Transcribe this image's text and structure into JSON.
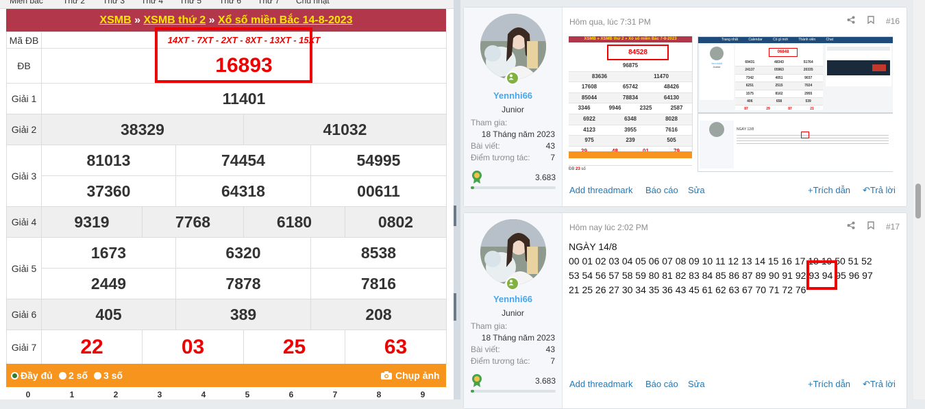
{
  "nav": [
    "Miền bắc",
    "Thứ 2",
    "Thứ 3",
    "Thứ 4",
    "Thứ 5",
    "Thứ 6",
    "Thứ 7",
    "Chủ nhật"
  ],
  "lottery": {
    "breadcrumb": [
      "XSMB",
      "XSMB thứ 2",
      "Xổ số miền Bắc 14-8-2023"
    ],
    "separator": "»",
    "ma_db_label": "Mã ĐB",
    "ma_db_value": "14XT - 7XT - 2XT - 8XT - 13XT - 15XT",
    "prizes": [
      {
        "label": "ĐB",
        "rows": [
          [
            "16893"
          ]
        ]
      },
      {
        "label": "Giải 1",
        "rows": [
          [
            "11401"
          ]
        ]
      },
      {
        "label": "Giải 2",
        "rows": [
          [
            "38329",
            "41032"
          ]
        ]
      },
      {
        "label": "Giải 3",
        "rows": [
          [
            "81013",
            "74454",
            "54995"
          ],
          [
            "37360",
            "64318",
            "00611"
          ]
        ]
      },
      {
        "label": "Giải 4",
        "rows": [
          [
            "9319",
            "7768",
            "6180",
            "0802"
          ]
        ]
      },
      {
        "label": "Giải 5",
        "rows": [
          [
            "1673",
            "6320",
            "8538"
          ],
          [
            "2449",
            "7878",
            "7816"
          ]
        ]
      },
      {
        "label": "Giải 6",
        "rows": [
          [
            "405",
            "389",
            "208"
          ]
        ]
      },
      {
        "label": "Giải 7",
        "rows": [
          [
            "22",
            "03",
            "25",
            "63"
          ]
        ]
      }
    ],
    "options": [
      "Đầy đủ",
      "2 số",
      "3 số"
    ],
    "capture_label": "Chụp ảnh",
    "digits": [
      "0",
      "1",
      "2",
      "3",
      "4",
      "5",
      "6",
      "7",
      "8",
      "9"
    ]
  },
  "posts": [
    {
      "date": "Hôm qua, lúc 7:31 PM",
      "number": "#16",
      "user": {
        "name": "Yennhi66",
        "title": "Junior",
        "joined_label": "Tham gia:",
        "joined": "18 Tháng năm 2023",
        "posts_label": "Bài viết:",
        "posts": "43",
        "reaction_label": "Điểm tương tác:",
        "reaction": "7",
        "points": "3.683"
      },
      "image": {
        "title": "XSMB » XSMB thứ 2 » Xổ số miền Bắc 7-8-2023",
        "db": "84528",
        "rows": [
          [
            "96875"
          ],
          [
            "83636",
            "11470"
          ],
          [
            "17608",
            "65742",
            "48426"
          ],
          [
            "85044",
            "78834",
            "64130"
          ],
          [
            "3346",
            "9946",
            "2325",
            "2587"
          ],
          [
            "6922",
            "6348",
            "8028"
          ],
          [
            "4123",
            "3955",
            "7616"
          ],
          [
            "975",
            "239",
            "505"
          ],
          [
            "29",
            "48",
            "01",
            "79"
          ]
        ],
        "inner_db": "06848",
        "inner_rows": [
          [
            "69431",
            "48343",
            "51764"
          ],
          [
            "24137",
            "05963",
            "20335"
          ],
          [
            "7342",
            "4051",
            "9037"
          ],
          [
            "6251",
            "2515",
            "7024"
          ],
          [
            "1575",
            "8162",
            "2955"
          ],
          [
            "406",
            "658",
            "539"
          ],
          [
            "87",
            "29",
            "87",
            "21"
          ]
        ],
        "inner_user": "Yennhi66",
        "inner_title": "Junior",
        "caption": "NGÀY 12/8",
        "bottom_label": "ĐB",
        "bottom_num": "23",
        "bottom_suffix": "số",
        "menu": [
          "Trang nhất",
          "Calendar",
          "Có gì mới",
          "Thành viên",
          "Chat"
        ]
      },
      "actions": {
        "threadmark": "Add threadmark",
        "report": "Báo cáo",
        "edit": "Sửa",
        "quote": "Trích dẫn",
        "reply": "Trả lời"
      }
    },
    {
      "date": "Hôm nay lúc 2:02 PM",
      "number": "#17",
      "user": {
        "name": "Yennhi66",
        "title": "Junior",
        "joined_label": "Tham gia:",
        "joined": "18 Tháng năm 2023",
        "posts_label": "Bài viết:",
        "posts": "43",
        "reaction_label": "Điểm tương tác:",
        "reaction": "7",
        "points": "3.683"
      },
      "message": [
        "NGÀY 14/8",
        "00 01 02 03 04 05 06 07 08 09 10 11 12 13 14 15 16 17 18 19 50 51 52",
        "53 54 56 57 58 59 80 81 82 83 84 85 86 87 89 90 91 92 93 94 95 96 97",
        "21 25 26 27 30 34 35 36 43 45 61 62 63 67 70 71 72 76"
      ],
      "actions": {
        "threadmark": "Add threadmark",
        "report": "Báo cáo",
        "edit": "Sửa",
        "quote": "Trích dẫn",
        "reply": "Trả lời"
      }
    }
  ],
  "colors": {
    "title_bg": "#b2374a",
    "link_yellow": "#ffe600",
    "red": "#e00000",
    "orange": "#f7941d",
    "forum_blue": "#2577b1",
    "username": "#47a7eb"
  }
}
